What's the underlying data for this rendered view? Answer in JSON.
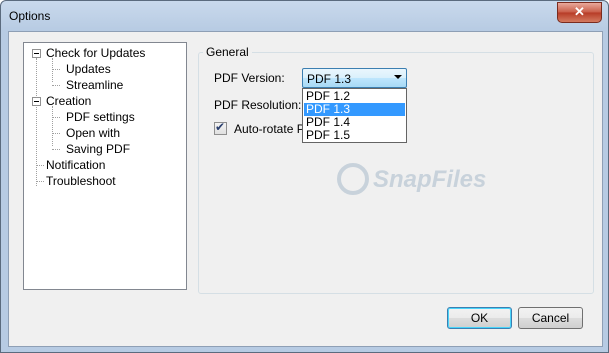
{
  "window": {
    "title": "Options",
    "close_glyph": "✕"
  },
  "tree": {
    "items": [
      {
        "label": "Check for Updates"
      },
      {
        "label": "Updates"
      },
      {
        "label": "Streamline"
      },
      {
        "label": "Creation"
      },
      {
        "label": "PDF settings"
      },
      {
        "label": "Open with"
      },
      {
        "label": "Saving PDF"
      },
      {
        "label": "Notification"
      },
      {
        "label": "Troubleshoot"
      }
    ]
  },
  "general": {
    "group_title": "General",
    "pdf_version_label": "PDF Version:",
    "pdf_version_value": "PDF 1.3",
    "pdf_version_options": [
      "PDF 1.2",
      "PDF 1.3",
      "PDF 1.4",
      "PDF 1.5"
    ],
    "selected_option": "PDF 1.3",
    "pdf_resolution_label": "PDF Resolution:",
    "auto_rotate_label": "Auto-rotate Pa",
    "auto_rotate_checked": true
  },
  "watermark": {
    "text": "SnapFiles"
  },
  "buttons": {
    "ok": "OK",
    "cancel": "Cancel"
  },
  "colors": {
    "selection": "#3399ff",
    "title_bar": "#b7cbe3",
    "close_button": "#c85b46"
  }
}
